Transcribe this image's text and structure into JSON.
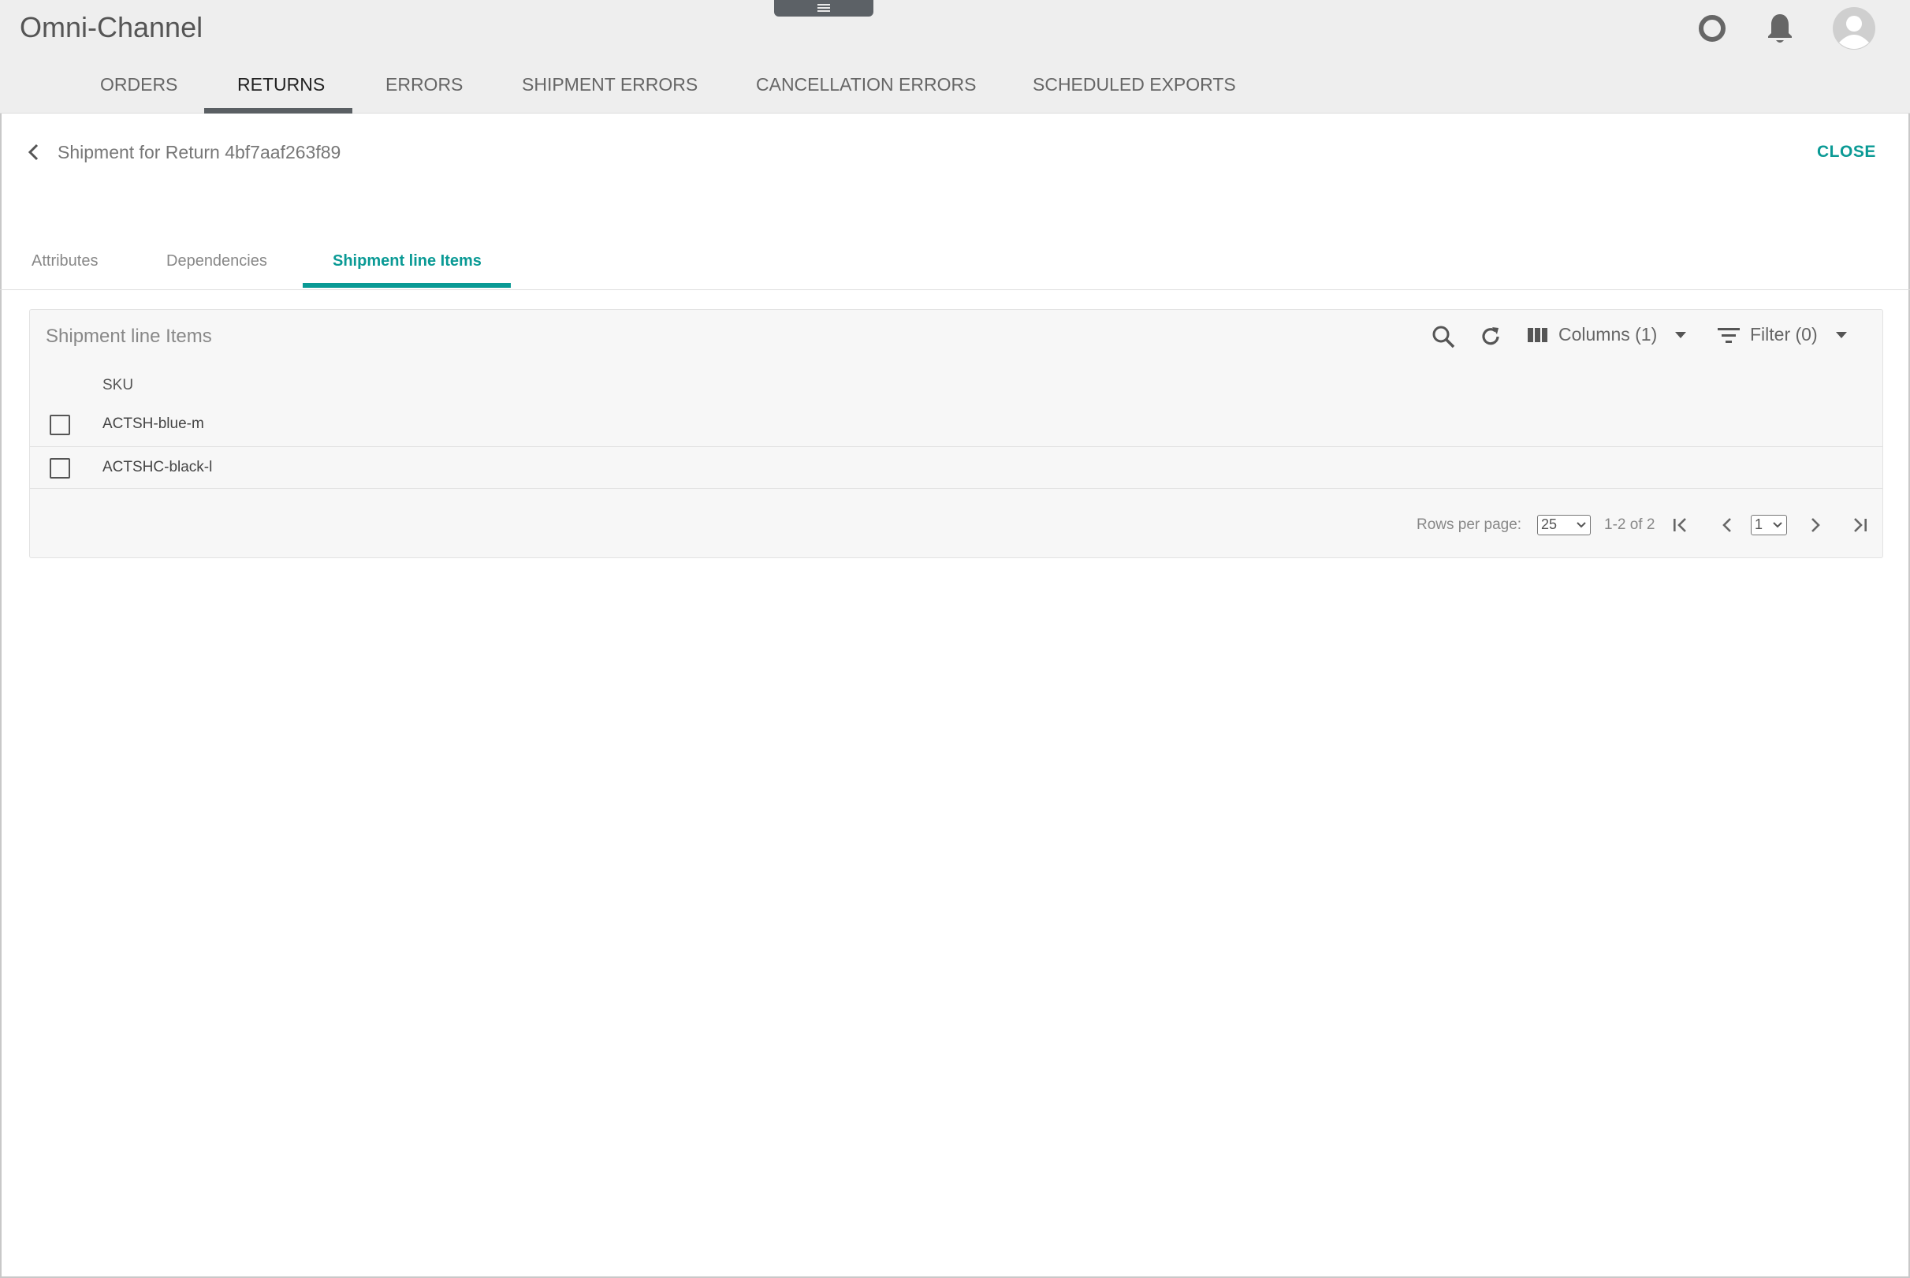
{
  "header": {
    "app_title": "Omni-Channel",
    "icons": [
      "status-circle-icon",
      "bell-icon",
      "user-avatar-icon"
    ],
    "tabs": [
      {
        "label": "ORDERS"
      },
      {
        "label": "RETURNS",
        "active": true
      },
      {
        "label": "ERRORS"
      },
      {
        "label": "SHIPMENT ERRORS"
      },
      {
        "label": "CANCELLATION ERRORS"
      },
      {
        "label": "SCHEDULED EXPORTS"
      }
    ]
  },
  "page": {
    "title": "Shipment for Return 4bf7aaf263f89",
    "close_label": "CLOSE"
  },
  "sub_tabs": [
    {
      "label": "Attributes"
    },
    {
      "label": "Dependencies"
    },
    {
      "label": "Shipment line Items",
      "active": true
    }
  ],
  "panel": {
    "title": "Shipment line Items",
    "columns_label": "Columns (1)",
    "filter_label": "Filter (0)",
    "column_header": "SKU",
    "rows": [
      {
        "sku": "ACTSH-blue-m"
      },
      {
        "sku": "ACTSHC-black-l"
      }
    ],
    "pagination": {
      "rows_per_page_label": "Rows per page:",
      "rows_per_page_value": "25",
      "range_text": "1-2 of 2",
      "page_value": "1"
    }
  },
  "colors": {
    "accent": "#0a9a95",
    "header_bg": "#eeeeee",
    "nav_underline": "#5a5f63"
  }
}
